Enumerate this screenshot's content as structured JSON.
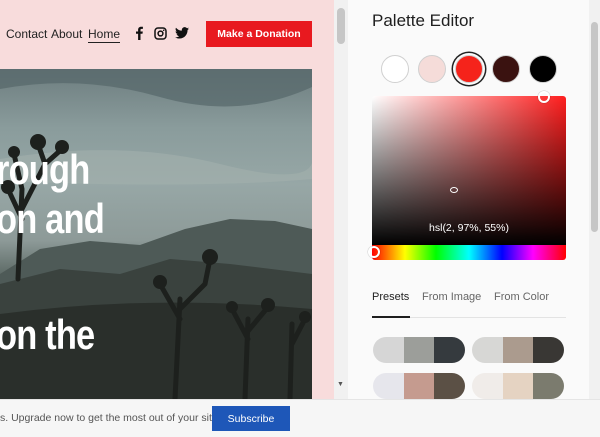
{
  "site": {
    "nav": {
      "contact": "Contact",
      "about": "About",
      "home": "Home"
    },
    "social_icons": [
      "facebook-icon",
      "instagram-icon",
      "twitter-icon"
    ],
    "donate_label": "Make a Donation",
    "hero_lines": [
      "rough",
      "on and",
      "on the"
    ],
    "accent_color": "#e8191f"
  },
  "editor": {
    "title": "Palette Editor",
    "swatches": [
      "#ffffff",
      "#f5dcd9",
      "#f5231b",
      "#3a1210",
      "#000000"
    ],
    "selected_swatch": 2,
    "color_value": "hsl(2, 97%, 55%)",
    "tabs": [
      "Presets",
      "From Image",
      "From Color"
    ],
    "active_tab": "Presets",
    "presets": [
      [
        "#d6d6d6",
        "#9c9e9a",
        "#353a3e"
      ],
      [
        "#d7d7d5",
        "#ab9b8e",
        "#393734"
      ],
      [
        "#e6e6ec",
        "#c59b8f",
        "#5b5045"
      ],
      [
        "#f0ece9",
        "#e5d3c2",
        "#7b7b6e"
      ]
    ]
  },
  "banner": {
    "text": "s. Upgrade now to get the most out of your site.",
    "subscribe_label": "Subscribe"
  }
}
